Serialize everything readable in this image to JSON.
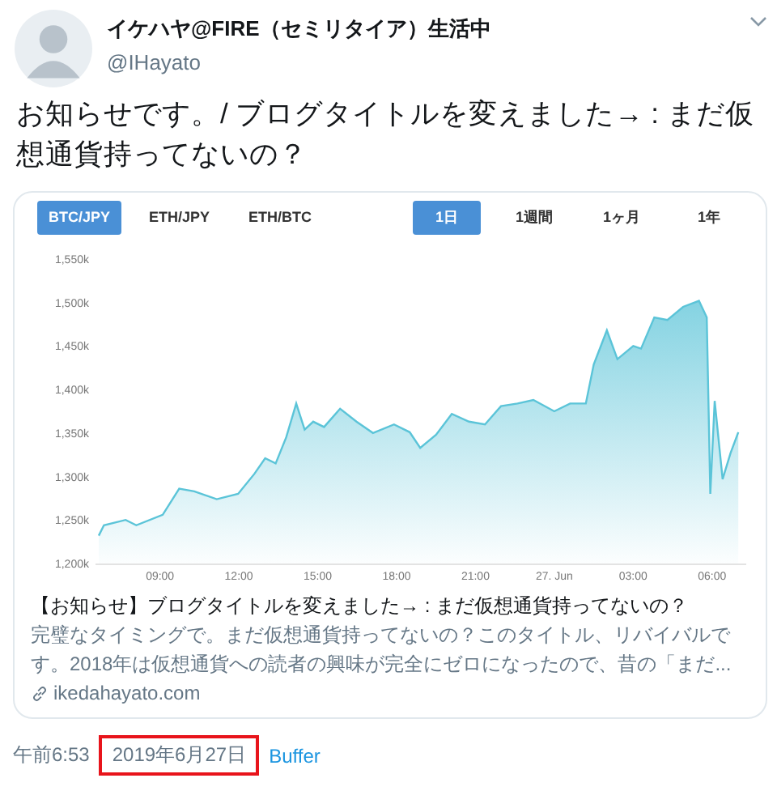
{
  "author": {
    "name": "イケハヤ@FIRE（セミリタイア）生活中",
    "handle": "@IHayato"
  },
  "tweet_text": "お知らせです。/ ブログタイトルを変えました→ : まだ仮想通貨持ってないの？",
  "card": {
    "pair_tabs": [
      {
        "label": "BTC/JPY",
        "selected": true
      },
      {
        "label": "ETH/JPY",
        "selected": false
      },
      {
        "label": "ETH/BTC",
        "selected": false
      }
    ],
    "period_tabs": [
      {
        "label": "1日",
        "selected": true
      },
      {
        "label": "1週間",
        "selected": false
      },
      {
        "label": "1ヶ月",
        "selected": false
      },
      {
        "label": "1年",
        "selected": false
      }
    ],
    "next_day_axis_labels": [
      "03:00",
      "06:00"
    ],
    "chart_data": {
      "type": "area",
      "xlim": [
        6.67,
        31.3
      ],
      "ylim": [
        1200,
        1550
      ],
      "xticks": [
        {
          "value": 9,
          "label": "09:00"
        },
        {
          "value": 12,
          "label": "12:00"
        },
        {
          "value": 15,
          "label": "15:00"
        },
        {
          "value": 18,
          "label": "18:00"
        },
        {
          "value": 21,
          "label": "21:00"
        },
        {
          "value": 24,
          "label": "27. Jun"
        }
      ],
      "yticks": [
        {
          "value": 1200,
          "label": "1,200k"
        },
        {
          "value": 1250,
          "label": "1,250k"
        },
        {
          "value": 1300,
          "label": "1,300k"
        },
        {
          "value": 1350,
          "label": "1,350k"
        },
        {
          "value": 1400,
          "label": "1,400k"
        },
        {
          "value": 1450,
          "label": "1,450k"
        },
        {
          "value": 1500,
          "label": "1,500k"
        },
        {
          "value": 1550,
          "label": "1,550k"
        }
      ],
      "x": [
        6.67,
        6.87,
        7.69,
        8.1,
        9.1,
        9.73,
        10.3,
        11.16,
        11.97,
        12.59,
        13.0,
        13.4,
        13.8,
        14.18,
        14.5,
        14.83,
        15.24,
        15.85,
        16.47,
        17.1,
        17.9,
        18.5,
        18.9,
        19.5,
        20.1,
        20.75,
        21.36,
        21.97,
        22.6,
        23.2,
        24.0,
        24.6,
        25.2,
        25.5,
        26.0,
        26.4,
        27.0,
        27.3,
        27.8,
        28.3,
        28.9,
        29.5,
        29.8,
        29.93,
        30.1,
        30.4,
        30.7,
        31.0
      ],
      "series": [
        {
          "color": "#5bc4d8",
          "values": [
            1232,
            1244,
            1250,
            1244,
            1256,
            1286,
            1283,
            1274,
            1280,
            1303,
            1321,
            1315,
            1345,
            1384,
            1354,
            1363,
            1357,
            1378,
            1363,
            1350,
            1360,
            1351,
            1333,
            1348,
            1372,
            1363,
            1360,
            1381,
            1384,
            1388,
            1375,
            1384,
            1384,
            1429,
            1468,
            1435,
            1450,
            1447,
            1483,
            1480,
            1495,
            1502,
            1483,
            1280,
            1387,
            1297,
            1327,
            1351
          ]
        }
      ]
    },
    "title": "【お知らせ】ブログタイトルを変えました→ : まだ仮想通貨持ってないの？",
    "description": "完璧なタイミングで。まだ仮想通貨持ってないの？このタイトル、リバイバルです。2018年は仮想通貨への読者の興味が完全にゼロになったので、昔の「まだ...",
    "domain": "ikedahayato.com"
  },
  "footer": {
    "time": "午前6:53",
    "date": "2019年6月27日",
    "date_highlighted": true,
    "source": "Buffer"
  }
}
